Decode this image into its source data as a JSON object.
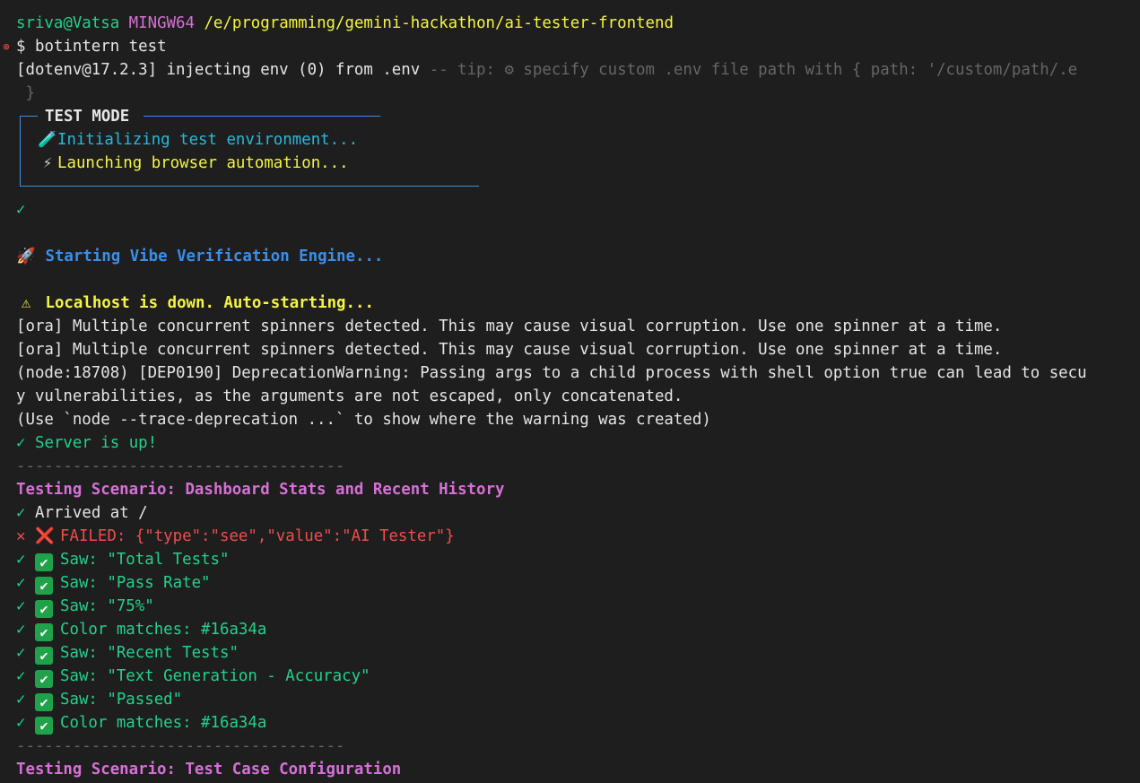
{
  "prompt": {
    "user": "sriva@Vatsa",
    "system": "MINGW64",
    "path": "/e/programming/gemini-hackathon/ai-tester-frontend",
    "symbol": "$",
    "command": "botintern test"
  },
  "dotenv": {
    "prefix": "[dotenv@17.2.3] injecting env (0) from .env",
    "tip_a": " -- tip: ",
    "tip_icon": "gear-icon",
    "tip_b": " specify custom .env file path with { path: '/custom/path/.e",
    "tip_cont": " }"
  },
  "test_mode_box": {
    "title": "TEST MODE",
    "line1": "Initializing test environment...",
    "line2": "Launching browser automation..."
  },
  "tick": "✓",
  "engine_start": "Starting Vibe Verification Engine...",
  "localhost_warning": "Localhost is down. Auto-starting...",
  "ora_warning": "[ora] Multiple concurrent spinners detected. This may cause visual corruption. Use one spinner at a time.",
  "deprecation": {
    "line1": "(node:18708) [DEP0190] DeprecationWarning: Passing args to a child process with shell option true can lead to secu",
    "line2": "y vulnerabilities, as the arguments are not escaped, only concatenated.",
    "line3": "(Use `node --trace-deprecation ...` to show where the warning was created)"
  },
  "server_up": "Server is up!",
  "separator": "-----------------------------------",
  "scenario1": {
    "title": "Testing Scenario: Dashboard Stats and Recent History",
    "arrived": "Arrived at /",
    "failed": "FAILED: {\"type\":\"see\",\"value\":\"AI Tester\"}",
    "results": [
      "Saw: \"Total Tests\"",
      "Saw: \"Pass Rate\"",
      "Saw: \"75%\"",
      "Color matches: #16a34a",
      "Saw: \"Recent Tests\"",
      "Saw: \"Text Generation - Accuracy\"",
      "Saw: \"Passed\"",
      "Color matches: #16a34a"
    ]
  },
  "scenario2": {
    "title": "Testing Scenario: Test Case Configuration"
  },
  "colors": {
    "background": "#1e1e1e",
    "green": "#23d18b",
    "magenta": "#d670d6",
    "yellow": "#f5f543",
    "blue": "#3b8eea",
    "red": "#f14c4c"
  }
}
